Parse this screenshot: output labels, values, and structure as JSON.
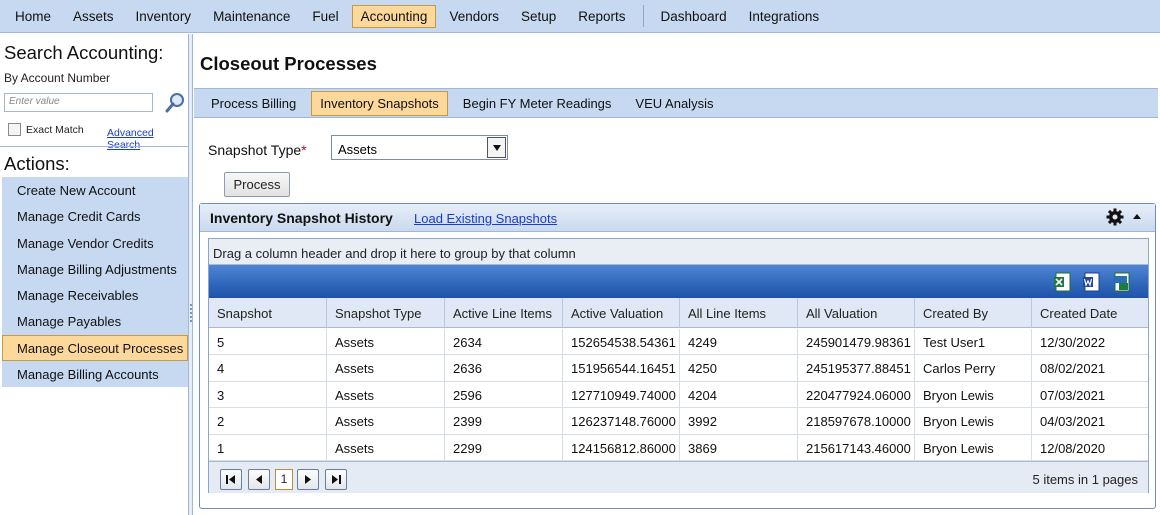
{
  "topnav": {
    "items": [
      {
        "label": "Home",
        "active": false
      },
      {
        "label": "Assets",
        "active": false
      },
      {
        "label": "Inventory",
        "active": false
      },
      {
        "label": "Maintenance",
        "active": false
      },
      {
        "label": "Fuel",
        "active": false
      },
      {
        "label": "Accounting",
        "active": true
      },
      {
        "label": "Vendors",
        "active": false
      },
      {
        "label": "Setup",
        "active": false
      },
      {
        "label": "Reports",
        "active": false
      }
    ],
    "items_right": [
      {
        "label": "Dashboard"
      },
      {
        "label": "Integrations"
      }
    ]
  },
  "sidebar": {
    "search_title": "Search Accounting:",
    "search_sub": "By Account Number",
    "search_placeholder": "Enter value",
    "exact_match_label": "Exact Match",
    "advanced_search_label": "Advanced Search",
    "actions_title": "Actions:",
    "actions": [
      {
        "label": "Create New Account",
        "active": false
      },
      {
        "label": "Manage Credit Cards",
        "active": false
      },
      {
        "label": "Manage Vendor Credits",
        "active": false
      },
      {
        "label": "Manage Billing Adjustments",
        "active": false
      },
      {
        "label": "Manage Receivables",
        "active": false
      },
      {
        "label": "Manage Payables",
        "active": false
      },
      {
        "label": "Manage Closeout Processes",
        "active": true
      },
      {
        "label": "Manage Billing Accounts",
        "active": false
      }
    ]
  },
  "main": {
    "page_title": "Closeout Processes",
    "tabs": [
      {
        "label": "Process Billing",
        "active": false
      },
      {
        "label": "Inventory Snapshots",
        "active": true
      },
      {
        "label": "Begin FY Meter Readings",
        "active": false
      },
      {
        "label": "VEU Analysis",
        "active": false
      }
    ],
    "snapshot_type_label": "Snapshot Type",
    "required_mark": "*",
    "snapshot_type_value": "Assets",
    "process_label": "Process"
  },
  "panel": {
    "title": "Inventory Snapshot History",
    "load_link": "Load Existing Snapshots",
    "group_hint": "Drag a column header and drop it here to group by that column",
    "columns": [
      "Snapshot",
      "Snapshot Type",
      "Active Line Items",
      "Active Valuation",
      "All Line Items",
      "All Valuation",
      "Created By",
      "Created Date"
    ],
    "rows": [
      [
        "5",
        "Assets",
        "2634",
        "152654538.54361",
        "4249",
        "245901479.98361",
        "Test User1",
        "12/30/2022"
      ],
      [
        "4",
        "Assets",
        "2636",
        "151956544.16451",
        "4250",
        "245195377.88451",
        "Carlos Perry",
        "08/02/2021"
      ],
      [
        "3",
        "Assets",
        "2596",
        "127710949.74000",
        "4204",
        "220477924.06000",
        "Bryon Lewis",
        "07/03/2021"
      ],
      [
        "2",
        "Assets",
        "2399",
        "126237148.76000",
        "3992",
        "218597678.10000",
        "Bryon Lewis",
        "04/03/2021"
      ],
      [
        "1",
        "Assets",
        "2299",
        "124156812.86000",
        "3869",
        "215617143.46000",
        "Bryon Lewis",
        "12/08/2020"
      ]
    ],
    "current_page": "1",
    "page_info": "5 items in 1 pages",
    "export_icons": [
      "excel-export-icon",
      "word-export-icon",
      "csv-export-icon"
    ]
  },
  "colors": {
    "nav_bg": "#c6d9f1",
    "active_bg": "#fdd89b",
    "toolbar_blue": "#1c52a8",
    "link": "#1a3ccd"
  }
}
